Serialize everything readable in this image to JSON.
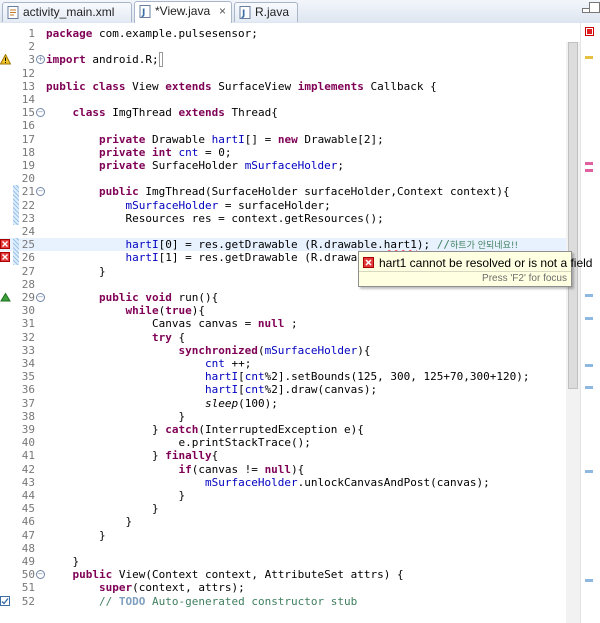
{
  "tabs": [
    {
      "label": "activity_main.xml",
      "active": false
    },
    {
      "label": "*View.java",
      "active": true
    },
    {
      "label": "R.java",
      "active": false
    }
  ],
  "close_glyph": "×",
  "fold": {
    "collapse": "−",
    "expand": "+"
  },
  "editor": {
    "lines": [
      {
        "num": "1",
        "code": "<span class=\"kw\">package</span> com.example.pulsesensor;"
      },
      {
        "num": "2",
        "code": ""
      },
      {
        "num": "3",
        "code": "<span class=\"kw\">import</span> android.R;<span style=\"border:1px solid #999;padding:0 1px;color:#777\">​</span>",
        "fold": "expand",
        "marker": "warning"
      },
      {
        "num": "12",
        "code": ""
      },
      {
        "num": "13",
        "code": "<span class=\"kw\">public</span> <span class=\"kw\">class</span> View <span class=\"kw\">extends</span> SurfaceView <span class=\"kw\">implements</span> Callback {"
      },
      {
        "num": "14",
        "code": ""
      },
      {
        "num": "15",
        "code": "    <span class=\"kw\">class</span> ImgThread <span class=\"kw\">extends</span> Thread{",
        "fold": "collapse"
      },
      {
        "num": "16",
        "code": ""
      },
      {
        "num": "17",
        "code": "        <span class=\"kw\">private</span> Drawable <span class=\"fld\">hartI</span>[] = <span class=\"kw\">new</span> Drawable[2];"
      },
      {
        "num": "18",
        "code": "        <span class=\"kw\">private</span> <span class=\"kw\">int</span> <span class=\"fld\">cnt</span> = 0;"
      },
      {
        "num": "19",
        "code": "        <span class=\"kw\">private</span> SurfaceHolder <span class=\"fld\">mSurfaceHolder</span>;"
      },
      {
        "num": "20",
        "code": ""
      },
      {
        "num": "21",
        "code": "        <span class=\"kw\">public</span> ImgThread(SurfaceHolder surfaceHolder,Context context){",
        "fold": "collapse"
      },
      {
        "num": "22",
        "code": "            <span class=\"fld\">mSurfaceHolder</span> = surfaceHolder;"
      },
      {
        "num": "23",
        "code": "            Resources res = context.getResources();"
      },
      {
        "num": "24",
        "code": ""
      },
      {
        "num": "25",
        "code": "            <span class=\"fld\">hartI</span>[0] = res.getDrawable (R.drawable.<span class=\"sq\">hart1</span>); <span class=\"cm\">//</span><span class=\"cm\" style=\"font-family:'DejaVu Sans',sans-serif;font-size:9px\">하트가 안되네요!!</span>",
        "marker": "error",
        "current": true
      },
      {
        "num": "26",
        "code": "            <span class=\"fld\">hartI</span>[1] = res.getDrawable (R.drawable.<span class=\"sq\">hart2</span>);",
        "marker": "error"
      },
      {
        "num": "27",
        "code": "        }"
      },
      {
        "num": "28",
        "code": ""
      },
      {
        "num": "29",
        "code": "        <span class=\"kw\">public</span> <span class=\"kw\">void</span> run(){",
        "fold": "collapse",
        "marker": "override"
      },
      {
        "num": "30",
        "code": "            <span class=\"kw\">while</span>(<span class=\"kw\">true</span>){"
      },
      {
        "num": "31",
        "code": "                Canvas canvas = <span class=\"kw\">null</span> ;"
      },
      {
        "num": "32",
        "code": "                <span class=\"kw\">try</span> {"
      },
      {
        "num": "33",
        "code": "                    <span class=\"kw\">synchronized</span>(<span class=\"fld\">mSurfaceHolder</span>){"
      },
      {
        "num": "34",
        "code": "                        <span class=\"fld\">cnt</span> ++;"
      },
      {
        "num": "35",
        "code": "                        <span class=\"fld\">hartI</span>[<span class=\"fld\">cnt</span>%2].setBounds(125, 300, 125+70,300+120);"
      },
      {
        "num": "36",
        "code": "                        <span class=\"fld\">hartI</span>[<span class=\"fld\">cnt</span>%2].draw(canvas);"
      },
      {
        "num": "37",
        "code": "                        <span class=\"itl\">sleep</span>(100);"
      },
      {
        "num": "38",
        "code": "                    }"
      },
      {
        "num": "39",
        "code": "                } <span class=\"kw\">catch</span>(InterruptedException e){"
      },
      {
        "num": "40",
        "code": "                    e.printStackTrace();"
      },
      {
        "num": "41",
        "code": "                } <span class=\"kw\">finally</span>{"
      },
      {
        "num": "42",
        "code": "                    <span class=\"kw\">if</span>(canvas != <span class=\"kw\">null</span>){"
      },
      {
        "num": "43",
        "code": "                        <span class=\"fld\">mSurfaceHolder</span>.unlockCanvasAndPost(canvas);"
      },
      {
        "num": "44",
        "code": "                    }"
      },
      {
        "num": "45",
        "code": "                }"
      },
      {
        "num": "46",
        "code": "            }"
      },
      {
        "num": "47",
        "code": "        }"
      },
      {
        "num": "48",
        "code": ""
      },
      {
        "num": "49",
        "code": "    }"
      },
      {
        "num": "50",
        "code": "    <span class=\"kw\">public</span> View(Context context, AttributeSet attrs) {",
        "fold": "collapse"
      },
      {
        "num": "51",
        "code": "        <span class=\"kw\">super</span>(context, attrs);"
      },
      {
        "num": "52",
        "code": "        <span class=\"cm\">// <span style=\"color:#7f9fbf;font-weight:bold\">TODO</span> Auto-generated constructor stub</span>",
        "marker": "task"
      }
    ]
  },
  "hover": {
    "message": "hart1 cannot be resolved or is not a field",
    "hint": "Press 'F2' for focus"
  }
}
